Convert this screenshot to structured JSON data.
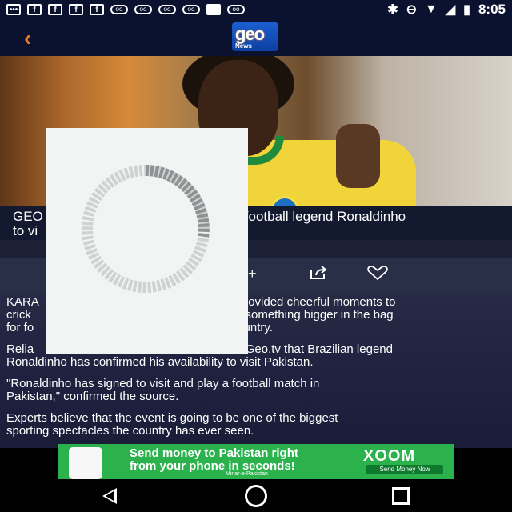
{
  "status_bar": {
    "time": "8:05",
    "left_icons": [
      "message-icon",
      "facebook-icon",
      "facebook-icon",
      "facebook-icon",
      "facebook-icon",
      "voicemail-icon",
      "voicemail-icon",
      "voicemail-icon",
      "voicemail-icon",
      "image-icon",
      "voicemail-icon"
    ],
    "right_icons": [
      "bluetooth-icon",
      "dnd-icon",
      "wifi-icon",
      "signal-icon",
      "battery-icon"
    ]
  },
  "toolbar": {
    "back_glyph": "‹",
    "logo_text": "geo",
    "logo_subtext": "News"
  },
  "article": {
    "headline_line1_start": "GEO",
    "headline_line1_end": "football legend Ronaldinho",
    "headline_line2_start": "to vi",
    "font_control": "A+",
    "paragraphs": [
      {
        "a": "KARA",
        "b": "provided cheerful moments to",
        "c": "crick",
        "d": "s something bigger in the bag",
        "e": "for fo",
        "f": "ountry."
      },
      {
        "a": "Relia",
        "b": "d Geo.tv that Brazilian legend",
        "line2": "Ronaldinho has confirmed his availability to visit Pakistan."
      },
      {
        "line1": "\"Ronaldinho has signed to visit and play a football match in",
        "line2": "Pakistan,\" confirmed the source."
      },
      {
        "line1": "Experts believe that the event is going to be one of the biggest",
        "line2": "sporting spectacles the country has ever seen."
      }
    ]
  },
  "ad": {
    "line1": "Send money to Pakistan right",
    "line2": "from your phone in seconds!",
    "brand": "XOOM",
    "button": "Send Money Now",
    "foot": "Minar-e-Pakistan"
  },
  "colors": {
    "bar_bg": "#0b1230",
    "accent_back": "#e07b26",
    "ad_green": "#2bb24c"
  }
}
